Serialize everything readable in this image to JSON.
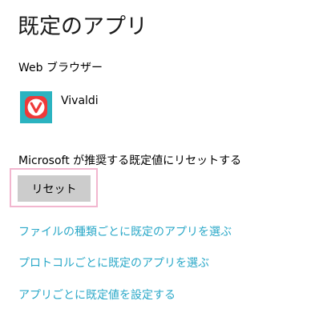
{
  "page": {
    "title": "既定のアプリ"
  },
  "web_browser": {
    "section_label": "Web ブラウザー",
    "app_name": "Vivaldi",
    "app_icon": "vivaldi-logo-icon",
    "tile_color": "#2bb3c0",
    "logo_color": "#ef3939"
  },
  "reset": {
    "label": "Microsoft が推奨する既定値にリセットする",
    "button_label": "リセット"
  },
  "links": {
    "by_file_type": "ファイルの種類ごとに既定のアプリを選ぶ",
    "by_protocol": "プロトコルごとに既定のアプリを選ぶ",
    "by_app": "アプリごとに既定値を設定する",
    "color": "#2aa8c8"
  }
}
